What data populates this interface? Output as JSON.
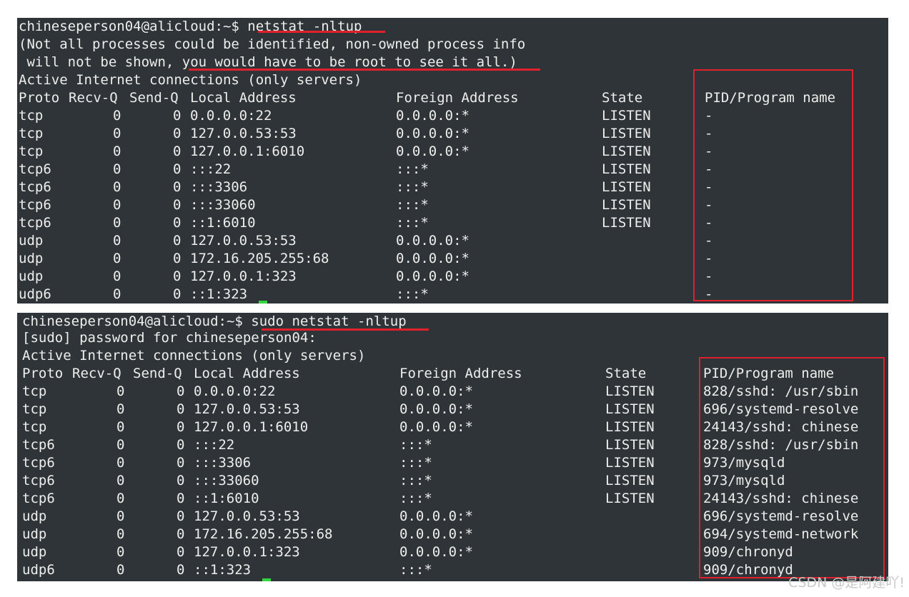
{
  "colors": {
    "terminal_bg": "#2e3437",
    "terminal_fg": "#eeeeec",
    "highlight": "#e0202a",
    "cursor": "#35d63f"
  },
  "watermark": "CSDN @是阿建吖!",
  "columns": [
    "Proto",
    "Recv-Q",
    "Send-Q",
    "Local Address",
    "Foreign Address",
    "State",
    "PID/Program name"
  ],
  "terminals": [
    {
      "prompt": "chineseperson04@alicloud:~$ ",
      "command": "netstat -nltup",
      "messages": [
        "(Not all processes could be identified, non-owned process info",
        " will not be shown, you would have to be root to see it all.)",
        "Active Internet connections (only servers)"
      ],
      "header": {
        "proto": "Proto",
        "recvq": "Recv-Q",
        "sendq": "Send-Q",
        "local": "Local Address",
        "foreign": "Foreign Address",
        "state": "State",
        "pid": "PID/Program name"
      },
      "rows": [
        {
          "proto": "tcp",
          "recvq": "0",
          "sendq": "0",
          "local": "0.0.0.0:22",
          "foreign": "0.0.0.0:*",
          "state": "LISTEN",
          "pid": "-"
        },
        {
          "proto": "tcp",
          "recvq": "0",
          "sendq": "0",
          "local": "127.0.0.53:53",
          "foreign": "0.0.0.0:*",
          "state": "LISTEN",
          "pid": "-"
        },
        {
          "proto": "tcp",
          "recvq": "0",
          "sendq": "0",
          "local": "127.0.0.1:6010",
          "foreign": "0.0.0.0:*",
          "state": "LISTEN",
          "pid": "-"
        },
        {
          "proto": "tcp6",
          "recvq": "0",
          "sendq": "0",
          "local": ":::22",
          "foreign": ":::*",
          "state": "LISTEN",
          "pid": "-"
        },
        {
          "proto": "tcp6",
          "recvq": "0",
          "sendq": "0",
          "local": ":::3306",
          "foreign": ":::*",
          "state": "LISTEN",
          "pid": "-"
        },
        {
          "proto": "tcp6",
          "recvq": "0",
          "sendq": "0",
          "local": ":::33060",
          "foreign": ":::*",
          "state": "LISTEN",
          "pid": "-"
        },
        {
          "proto": "tcp6",
          "recvq": "0",
          "sendq": "0",
          "local": "::1:6010",
          "foreign": ":::*",
          "state": "LISTEN",
          "pid": "-"
        },
        {
          "proto": "udp",
          "recvq": "0",
          "sendq": "0",
          "local": "127.0.0.53:53",
          "foreign": "0.0.0.0:*",
          "state": "",
          "pid": "-"
        },
        {
          "proto": "udp",
          "recvq": "0",
          "sendq": "0",
          "local": "172.16.205.255:68",
          "foreign": "0.0.0.0:*",
          "state": "",
          "pid": "-"
        },
        {
          "proto": "udp",
          "recvq": "0",
          "sendq": "0",
          "local": "127.0.0.1:323",
          "foreign": "0.0.0.0:*",
          "state": "",
          "pid": "-"
        },
        {
          "proto": "udp6",
          "recvq": "0",
          "sendq": "0",
          "local": "::1:323",
          "foreign": ":::*",
          "state": "",
          "pid": "-"
        }
      ]
    },
    {
      "prompt": "chineseperson04@alicloud:~$ ",
      "command": "sudo netstat -nltup",
      "messages": [
        "[sudo] password for chineseperson04:",
        "Active Internet connections (only servers)"
      ],
      "header": {
        "proto": "Proto",
        "recvq": "Recv-Q",
        "sendq": "Send-Q",
        "local": "Local Address",
        "foreign": "Foreign Address",
        "state": "State",
        "pid": "PID/Program name"
      },
      "rows": [
        {
          "proto": "tcp",
          "recvq": "0",
          "sendq": "0",
          "local": "0.0.0.0:22",
          "foreign": "0.0.0.0:*",
          "state": "LISTEN",
          "pid": "828/sshd: /usr/sbin"
        },
        {
          "proto": "tcp",
          "recvq": "0",
          "sendq": "0",
          "local": "127.0.0.53:53",
          "foreign": "0.0.0.0:*",
          "state": "LISTEN",
          "pid": "696/systemd-resolve"
        },
        {
          "proto": "tcp",
          "recvq": "0",
          "sendq": "0",
          "local": "127.0.0.1:6010",
          "foreign": "0.0.0.0:*",
          "state": "LISTEN",
          "pid": "24143/sshd: chinese"
        },
        {
          "proto": "tcp6",
          "recvq": "0",
          "sendq": "0",
          "local": ":::22",
          "foreign": ":::*",
          "state": "LISTEN",
          "pid": "828/sshd: /usr/sbin"
        },
        {
          "proto": "tcp6",
          "recvq": "0",
          "sendq": "0",
          "local": ":::3306",
          "foreign": ":::*",
          "state": "LISTEN",
          "pid": "973/mysqld"
        },
        {
          "proto": "tcp6",
          "recvq": "0",
          "sendq": "0",
          "local": ":::33060",
          "foreign": ":::*",
          "state": "LISTEN",
          "pid": "973/mysqld"
        },
        {
          "proto": "tcp6",
          "recvq": "0",
          "sendq": "0",
          "local": "::1:6010",
          "foreign": ":::*",
          "state": "LISTEN",
          "pid": "24143/sshd: chinese"
        },
        {
          "proto": "udp",
          "recvq": "0",
          "sendq": "0",
          "local": "127.0.0.53:53",
          "foreign": "0.0.0.0:*",
          "state": "",
          "pid": "696/systemd-resolve"
        },
        {
          "proto": "udp",
          "recvq": "0",
          "sendq": "0",
          "local": "172.16.205.255:68",
          "foreign": "0.0.0.0:*",
          "state": "",
          "pid": "694/systemd-network"
        },
        {
          "proto": "udp",
          "recvq": "0",
          "sendq": "0",
          "local": "127.0.0.1:323",
          "foreign": "0.0.0.0:*",
          "state": "",
          "pid": "909/chronyd"
        },
        {
          "proto": "udp6",
          "recvq": "0",
          "sendq": "0",
          "local": "::1:323",
          "foreign": ":::*",
          "state": "",
          "pid": "909/chronyd"
        }
      ]
    }
  ]
}
